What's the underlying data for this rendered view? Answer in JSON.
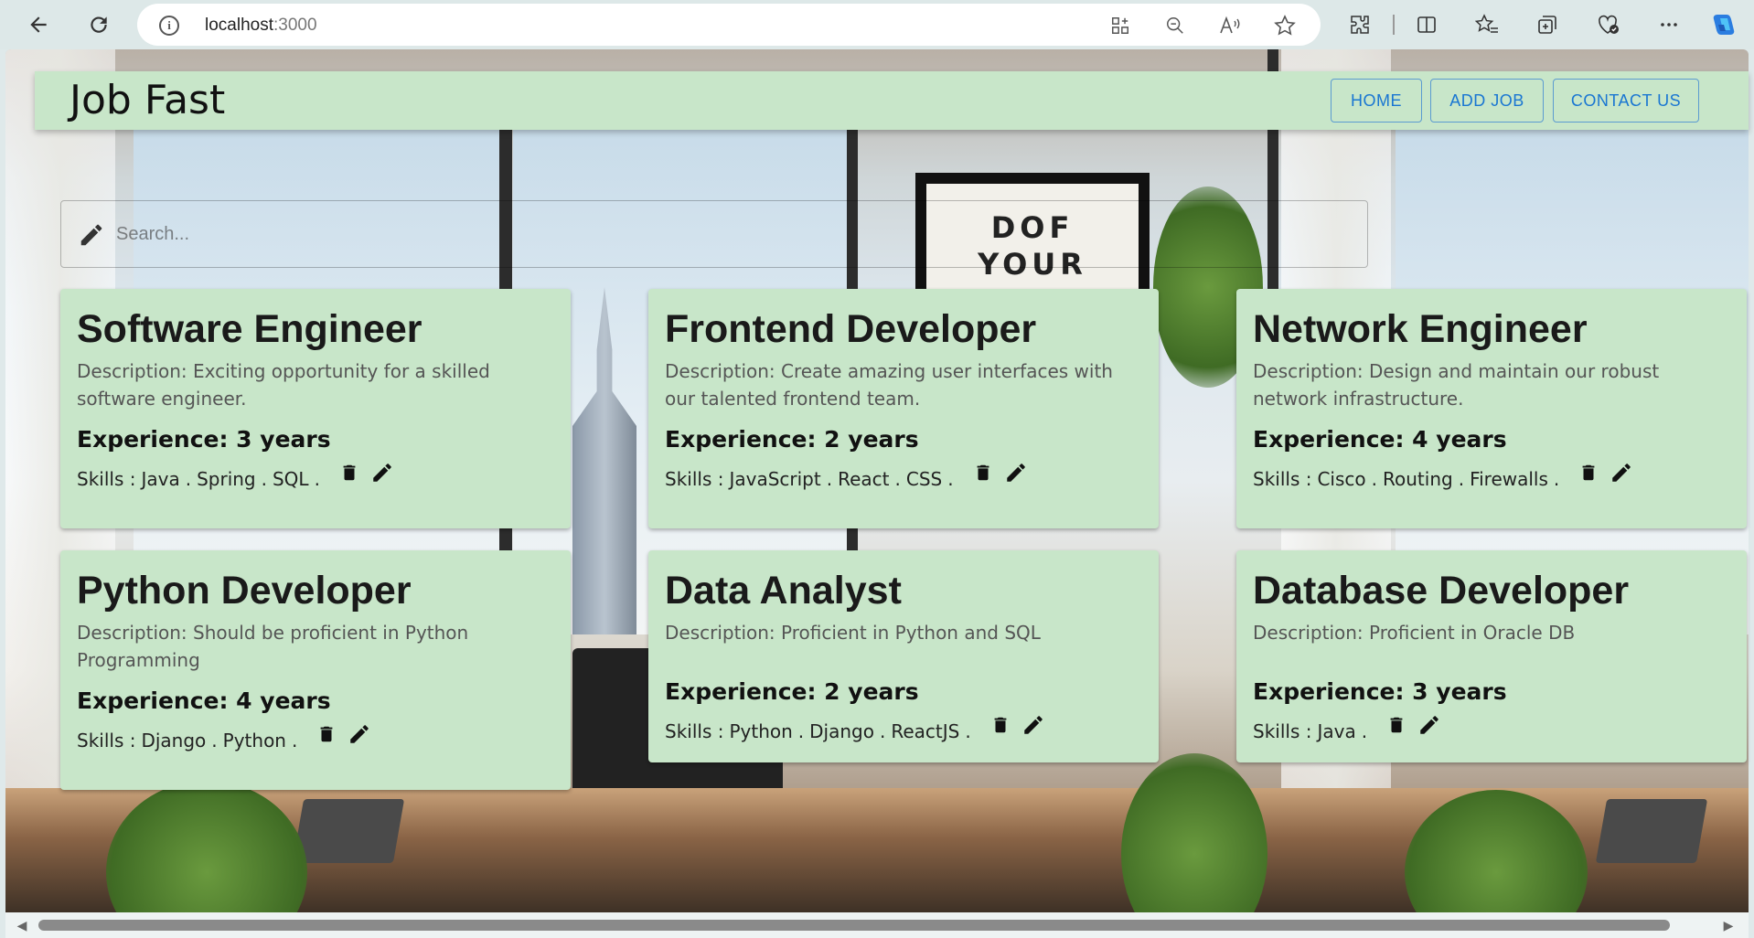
{
  "browser": {
    "url_host": "localhost",
    "url_port": ":3000",
    "info_icon": "i"
  },
  "app": {
    "title": "Job Fast",
    "nav": [
      "HOME",
      "ADD JOB",
      "CONTACT US"
    ]
  },
  "search": {
    "placeholder": "Search..."
  },
  "background": {
    "poster_text": "DOF\nYOUR\nNOM"
  },
  "jobs": [
    {
      "title": "Software Engineer",
      "description": "Description: Exciting opportunity for a skilled software engineer.",
      "experience": "Experience: 3 years",
      "skills_label": "Skills :",
      "skills": [
        "Java",
        "Spring",
        "SQL"
      ]
    },
    {
      "title": "Frontend Developer",
      "description": "Description: Create amazing user interfaces with our talented frontend team.",
      "experience": "Experience: 2 years",
      "skills_label": "Skills :",
      "skills": [
        "JavaScript",
        "React",
        "CSS"
      ]
    },
    {
      "title": "Network Engineer",
      "description": "Description: Design and maintain our robust network infrastructure.",
      "experience": "Experience: 4 years",
      "skills_label": "Skills :",
      "skills": [
        "Cisco",
        "Routing",
        "Firewalls"
      ]
    },
    {
      "title": "Python Developer",
      "description": "Description: Should be proficient in Python Programming",
      "experience": "Experience: 4 years",
      "skills_label": "Skills :",
      "skills": [
        "Django",
        "Python"
      ]
    },
    {
      "title": "Data Analyst",
      "description": "Description: Proficient in Python and SQL",
      "experience": "Experience: 2 years",
      "skills_label": "Skills :",
      "skills": [
        "Python",
        "Django",
        "ReactJS"
      ]
    },
    {
      "title": "Database Developer",
      "description": "Description: Proficient in Oracle DB",
      "experience": "Experience: 3 years",
      "skills_label": "Skills :",
      "skills": [
        "Java"
      ]
    }
  ],
  "colors": {
    "card_bg": "#c8e6c9",
    "nav_text": "#1976d2",
    "browser_bg": "#dde8e8"
  }
}
